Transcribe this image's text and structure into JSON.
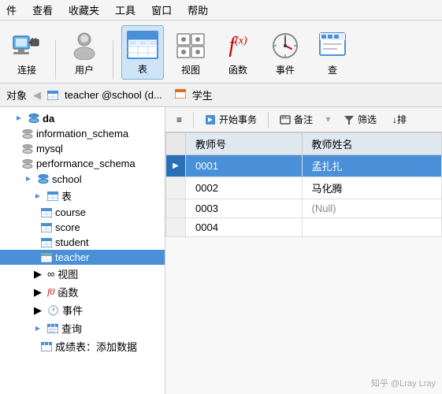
{
  "menubar": {
    "items": [
      "件",
      "查看",
      "收藏夹",
      "工具",
      "窗口",
      "帮助"
    ]
  },
  "toolbar": {
    "items": [
      {
        "id": "connect",
        "label": "连接",
        "icon": "connect"
      },
      {
        "id": "user",
        "label": "用户",
        "icon": "user"
      },
      {
        "id": "table",
        "label": "表",
        "icon": "table",
        "active": true
      },
      {
        "id": "view",
        "label": "视图",
        "icon": "view"
      },
      {
        "id": "function",
        "label": "函数",
        "icon": "function"
      },
      {
        "id": "event",
        "label": "事件",
        "icon": "event"
      },
      {
        "id": "query",
        "label": "查",
        "icon": "query"
      }
    ]
  },
  "objectbar": {
    "label": "对象",
    "tabs": [
      {
        "id": "teacher",
        "label": "teacher @school (d...",
        "icon": "table"
      },
      {
        "id": "student",
        "label": "学生",
        "icon": "table"
      }
    ]
  },
  "sidebar": {
    "items": [
      {
        "id": "da",
        "label": "da",
        "level": 0,
        "type": "db",
        "expanded": true
      },
      {
        "id": "information_schema",
        "label": "information_schema",
        "level": 1,
        "type": "db"
      },
      {
        "id": "mysql",
        "label": "mysql",
        "level": 1,
        "type": "db"
      },
      {
        "id": "performance_schema",
        "label": "performance_schema",
        "level": 1,
        "type": "db"
      },
      {
        "id": "school",
        "label": "school",
        "level": 1,
        "type": "db",
        "expanded": true
      },
      {
        "id": "tables",
        "label": "表",
        "level": 2,
        "type": "table-group",
        "expanded": true
      },
      {
        "id": "course",
        "label": "course",
        "level": 3,
        "type": "table"
      },
      {
        "id": "score",
        "label": "score",
        "level": 3,
        "type": "table"
      },
      {
        "id": "student",
        "label": "student",
        "level": 3,
        "type": "table"
      },
      {
        "id": "teacher",
        "label": "teacher",
        "level": 3,
        "type": "table",
        "selected": true
      },
      {
        "id": "views",
        "label": "视图",
        "level": 2,
        "type": "view-group"
      },
      {
        "id": "functions",
        "label": "函数",
        "level": 2,
        "type": "func-group"
      },
      {
        "id": "events",
        "label": "事件",
        "level": 2,
        "type": "event-group"
      },
      {
        "id": "queries",
        "label": "查询",
        "level": 2,
        "type": "query-group",
        "expanded": true
      },
      {
        "id": "score_report",
        "label": "成绩表：添加数据",
        "level": 3,
        "type": "query"
      }
    ]
  },
  "content_toolbar": {
    "buttons": [
      {
        "id": "menu",
        "label": "≡",
        "icon": "menu"
      },
      {
        "id": "transaction",
        "label": "开始事务",
        "icon": "transaction"
      },
      {
        "id": "backup",
        "label": "备注",
        "icon": "backup"
      },
      {
        "id": "filter-label",
        "label": "▼ 筛选",
        "icon": "filter"
      },
      {
        "id": "sort",
        "label": "↓排",
        "icon": "sort"
      }
    ]
  },
  "table": {
    "columns": [
      "教师号",
      "教师姓名"
    ],
    "rows": [
      {
        "id": "0001",
        "name": "孟扎扎",
        "selected": true
      },
      {
        "id": "0002",
        "name": "马化腾",
        "selected": false
      },
      {
        "id": "0003",
        "name": "(Null)",
        "selected": false,
        "null": true
      },
      {
        "id": "0004",
        "name": "",
        "selected": false
      }
    ]
  },
  "watermark": "知乎 @Lray Lray"
}
